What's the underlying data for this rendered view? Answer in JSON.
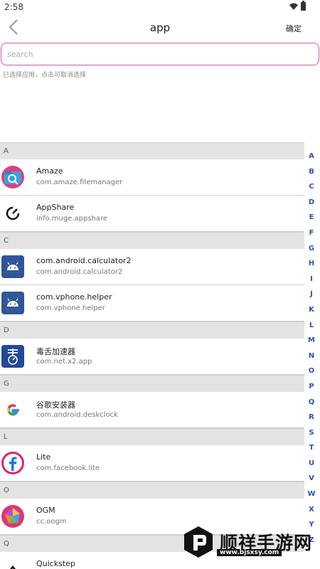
{
  "status_bar": {
    "time": "2:58"
  },
  "toolbar": {
    "title": "app",
    "confirm_label": "确定"
  },
  "search": {
    "placeholder": "search",
    "value": ""
  },
  "hint": "已选择应用，点击可取消选择",
  "sections": [
    {
      "letter": "A",
      "apps": [
        {
          "name": "Amaze",
          "package": "com.amaze.filemanager",
          "icon": "amaze-icon"
        },
        {
          "name": "AppShare",
          "package": "info.muge.appshare",
          "icon": "appshare-icon"
        }
      ]
    },
    {
      "letter": "C",
      "apps": [
        {
          "name": "com.android.calculator2",
          "package": "com.android.calculator2",
          "icon": "android-icon"
        },
        {
          "name": "com.vphone.helper",
          "package": "com.vphone.helper",
          "icon": "android-icon"
        }
      ]
    },
    {
      "letter": "D",
      "apps": [
        {
          "name": "毒舌加速器",
          "package": "com.net.x2.app",
          "icon": "dushe-icon"
        }
      ]
    },
    {
      "letter": "G",
      "apps": [
        {
          "name": "谷歌安装器",
          "package": "com.android.deskclock",
          "icon": "google-icon"
        }
      ]
    },
    {
      "letter": "L",
      "apps": [
        {
          "name": "Lite",
          "package": "com.facebook.lite",
          "icon": "facebook-icon"
        }
      ]
    },
    {
      "letter": "O",
      "apps": [
        {
          "name": "OGM",
          "package": "cc.oogm",
          "icon": "ogm-icon"
        }
      ]
    },
    {
      "letter": "Q",
      "apps": [
        {
          "name": "Quickstep",
          "package": "",
          "icon": "quickstep-icon"
        }
      ]
    }
  ],
  "alphabet": [
    "A",
    "B",
    "C",
    "D",
    "E",
    "F",
    "G",
    "H",
    "I",
    "J",
    "K",
    "L",
    "M",
    "N",
    "O",
    "P",
    "Q",
    "R",
    "S",
    "T",
    "U",
    "V",
    "W",
    "X",
    "Y",
    "Z"
  ],
  "watermark": {
    "text": "顺祥手游网",
    "url": "www.bjsxsy.com"
  },
  "colors": {
    "accent": "#d45aa8",
    "index": "#2a53b5",
    "section_bg": "#e3e3e3"
  }
}
